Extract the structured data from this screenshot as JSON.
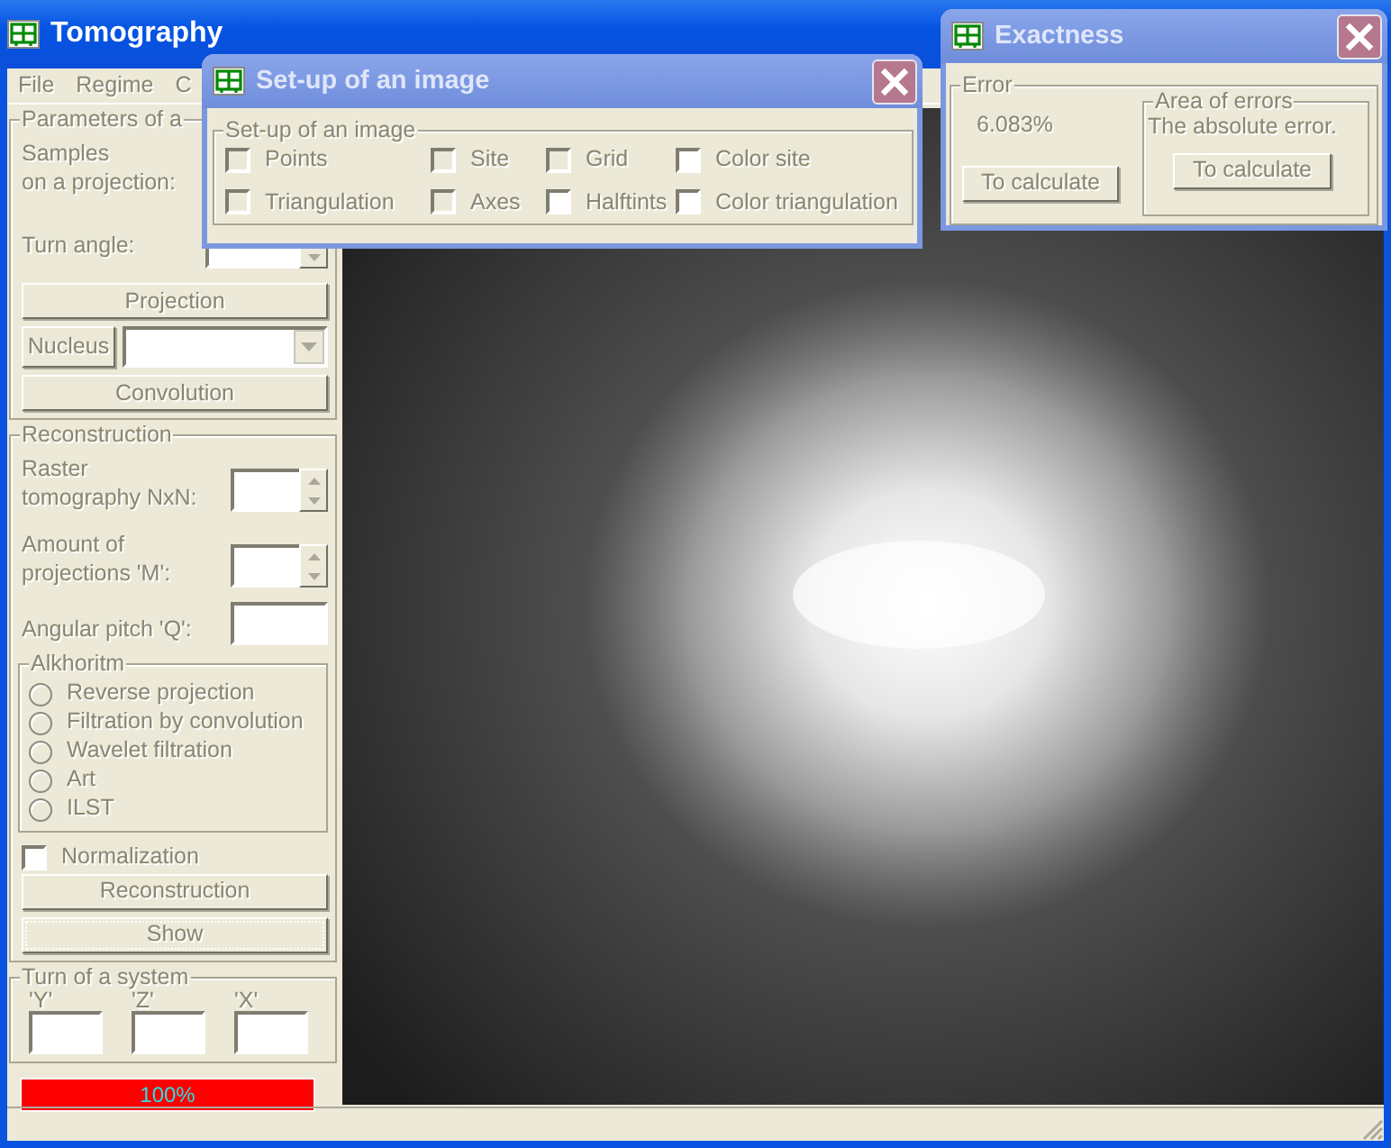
{
  "main_window": {
    "title": "Tomography"
  },
  "menu": [
    "File",
    "Regime",
    "C"
  ],
  "parameters": {
    "title": "Parameters of a",
    "samples_label": [
      "Samples",
      "on a projection:"
    ],
    "turn_angle_label": "Turn angle:",
    "projection_button": "Projection",
    "nucleus_button": "Nucleus",
    "convolution_button": "Convolution"
  },
  "reconstruction": {
    "title": "Reconstruction",
    "raster_label": [
      "Raster",
      "tomography NxN:"
    ],
    "amount_label": [
      "Amount of",
      "projections 'M':"
    ],
    "pitch_label": "Angular pitch 'Q':",
    "algorithm": {
      "title": "Alkhoritm",
      "options": [
        {
          "label": "Reverse projection",
          "selected": false
        },
        {
          "label": "Filtration by convolution",
          "selected": false
        },
        {
          "label": "Wavelet filtration",
          "selected": false
        },
        {
          "label": "Art",
          "selected": false
        },
        {
          "label": "ILST",
          "selected": false
        }
      ]
    },
    "normalization": {
      "label": "Normalization",
      "checked": false
    },
    "reconstruction_button": "Reconstruction",
    "show_button": "Show"
  },
  "turn_of_system": {
    "title": "Turn of a system",
    "axes": [
      "'Y'",
      "'Z'",
      "'X'"
    ]
  },
  "progress": {
    "label": "100%",
    "level": 1
  },
  "setup_dialog": {
    "title": "Set-up of an image",
    "group_title": "Set-up of an image",
    "options": [
      {
        "label": "Points",
        "checked": false,
        "disabled": true
      },
      {
        "label": "Site",
        "checked": false,
        "disabled": true
      },
      {
        "label": "Grid",
        "checked": false,
        "disabled": true
      },
      {
        "label": "Color site",
        "checked": false,
        "disabled": false
      },
      {
        "label": "Triangulation",
        "checked": false,
        "disabled": true
      },
      {
        "label": "Axes",
        "checked": false,
        "disabled": true
      },
      {
        "label": "Halftints",
        "checked": false,
        "disabled": false
      },
      {
        "label": "Color triangulation",
        "checked": false,
        "disabled": false
      }
    ]
  },
  "exactness_dialog": {
    "title": "Exactness",
    "error_group": {
      "title": "Error",
      "value": "6.083%",
      "button": "To calculate"
    },
    "area_group": {
      "title": "Area of errors",
      "text": "The absolute error.",
      "button": "To calculate"
    }
  }
}
